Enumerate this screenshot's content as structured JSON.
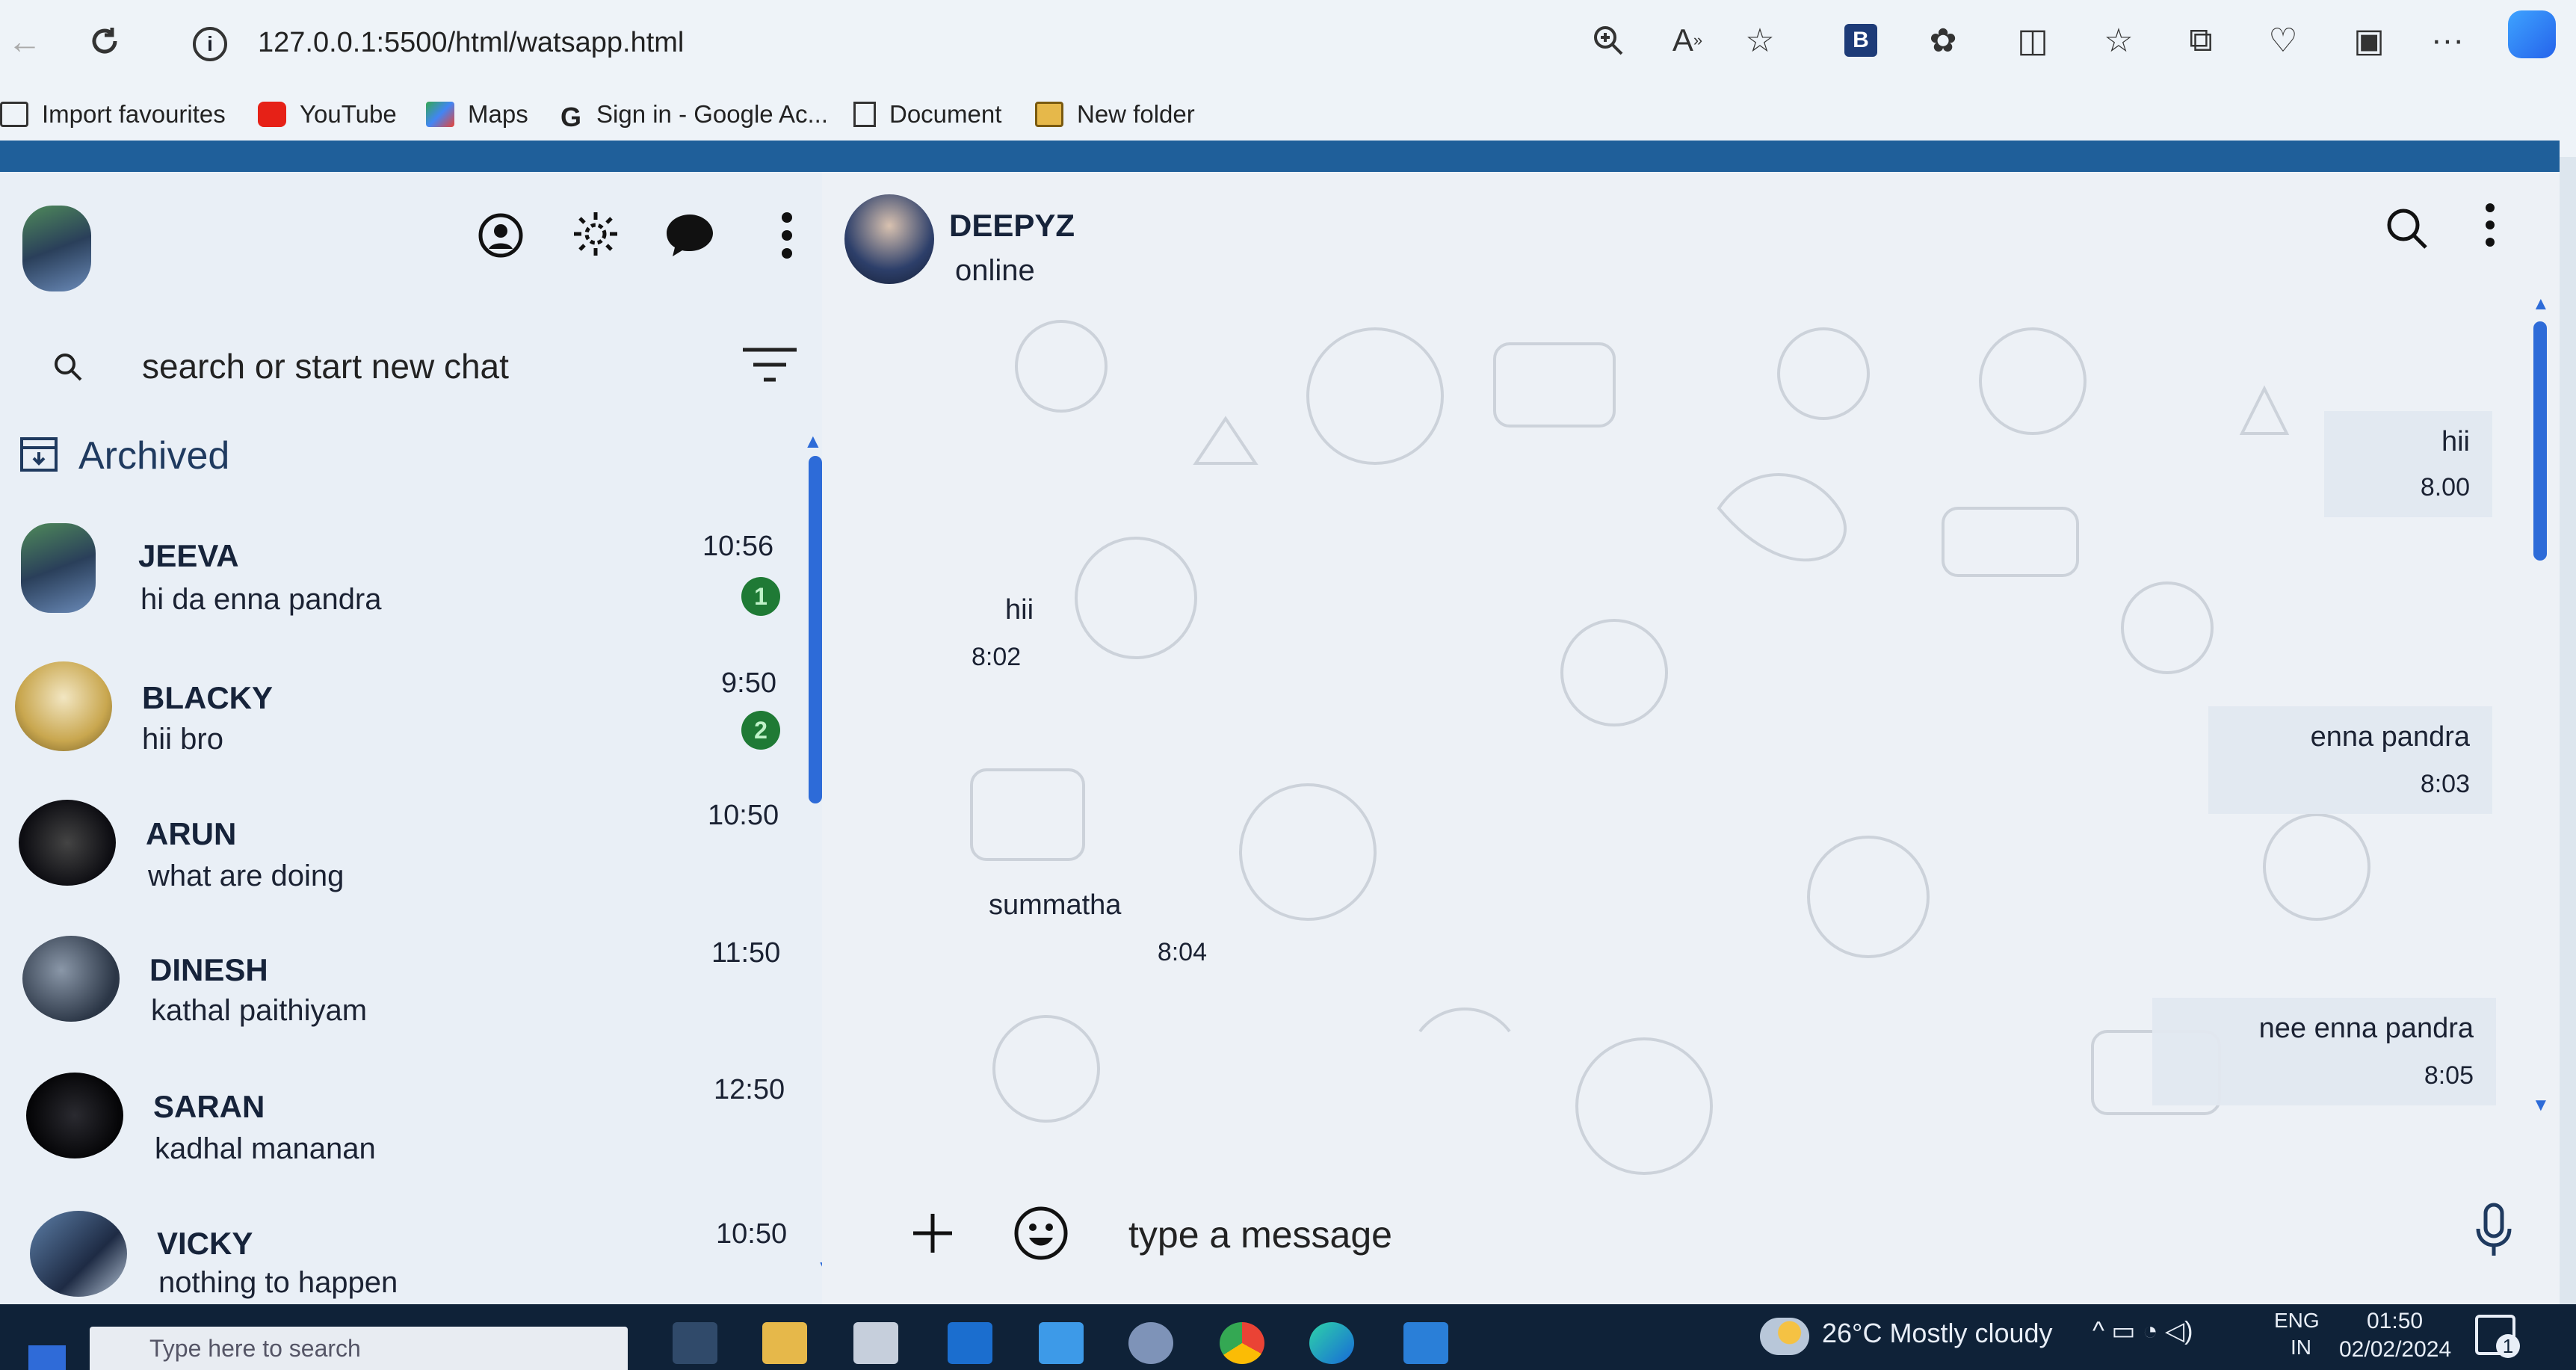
{
  "browser": {
    "url": "127.0.0.1:5500/html/watsapp.html",
    "bookmarks": [
      {
        "label": "Import favourites",
        "icon": "import-icon"
      },
      {
        "label": "YouTube",
        "icon": "youtube-icon"
      },
      {
        "label": "Maps",
        "icon": "maps-icon"
      },
      {
        "label": "Sign in - Google Ac...",
        "icon": "google-icon"
      },
      {
        "label": "Document",
        "icon": "document-icon"
      },
      {
        "label": "New folder",
        "icon": "folder-icon"
      }
    ],
    "toolbar_icons": [
      "zoom-icon",
      "read-aloud-icon",
      "star-icon",
      "bing-icon",
      "extension-icon",
      "split-screen-icon",
      "favourites-icon",
      "collections-icon",
      "performance-icon",
      "sidebar-icon",
      "more-icon",
      "copilot-icon"
    ]
  },
  "sidebar": {
    "search_placeholder": "search or start new chat",
    "archived_label": "Archived",
    "chats": [
      {
        "name": "JEEVA",
        "message": "hi da enna pandra",
        "time": "10:56",
        "unread": "1"
      },
      {
        "name": "BLACKY",
        "message": "hii bro",
        "time": "9:50",
        "unread": "2"
      },
      {
        "name": "ARUN",
        "message": "what are doing",
        "time": "10:50",
        "unread": ""
      },
      {
        "name": "DINESH",
        "message": "kathal paithiyam",
        "time": "11:50",
        "unread": ""
      },
      {
        "name": "SARAN",
        "message": "kadhal mananan",
        "time": "12:50",
        "unread": ""
      },
      {
        "name": "VICKY",
        "message": "nothing to happen",
        "time": "10:50",
        "unread": ""
      }
    ]
  },
  "conversation": {
    "contact_name": "DEEPYZ",
    "contact_status": "online",
    "messages": [
      {
        "text": "hii",
        "time": "8.00",
        "direction": "outgoing"
      },
      {
        "text": "hii",
        "time": "8:02",
        "direction": "incoming"
      },
      {
        "text": "enna pandra",
        "time": "8:03",
        "direction": "outgoing"
      },
      {
        "text": "summatha",
        "time": "8:04",
        "direction": "incoming"
      },
      {
        "text": "nee enna pandra",
        "time": "8:05",
        "direction": "outgoing"
      }
    ],
    "composer_placeholder": "type a message"
  },
  "taskbar": {
    "search_placeholder": "Type here to search",
    "weather": "26°C  Mostly cloudy",
    "language": "ENG",
    "region": "IN",
    "time": "01:50",
    "date": "02/02/2024",
    "notification_count": "1"
  },
  "colors": {
    "accent_blue": "#1f5f9a",
    "badge_green": "#1f7a35",
    "scrollbar": "#2d6bd8"
  }
}
